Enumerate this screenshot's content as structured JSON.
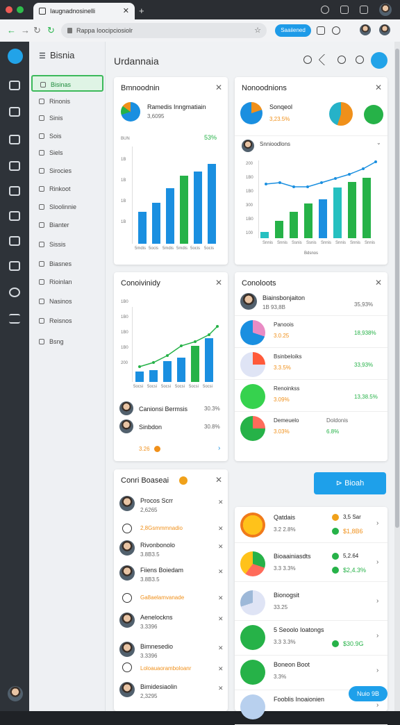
{
  "browser": {
    "tab_title": "Iaugnadnosinelli",
    "url": "Rappa Ioocipciosiolr",
    "pill_label": "Saaiiened"
  },
  "sidebar": {
    "title": "Bisnia",
    "items": [
      {
        "label": "Bisinas"
      },
      {
        "label": "Rinonis"
      },
      {
        "label": "Sinis"
      },
      {
        "label": "Sois"
      },
      {
        "label": "Siels"
      },
      {
        "label": "Sirocies"
      },
      {
        "label": "Rinkoot"
      },
      {
        "label": "Sloolinnie"
      },
      {
        "label": "Bianter"
      },
      {
        "label": "Sissis"
      },
      {
        "label": "Biasnes"
      },
      {
        "label": "Rioinlan"
      },
      {
        "label": "Nasinos"
      },
      {
        "label": "Reisnos"
      },
      {
        "label": "Bsng"
      }
    ]
  },
  "main": {
    "title": "Urdannaia"
  },
  "card1": {
    "title": "Bmnoodnin",
    "legend_name": "Ramedis Inngmatiain",
    "legend_sub": "3,6095",
    "top_value": "53%",
    "axis": [
      "BUN",
      "1B",
      "1B",
      "1B",
      "1B"
    ],
    "x_labels": [
      "5mdis",
      "5ocis",
      "5mdis",
      "5mdis",
      "5ocis",
      "5ocis"
    ]
  },
  "card2": {
    "title": "Nonoodnions",
    "name": "Sonqeol",
    "value": "3,23.5%",
    "person": "Snnioodlons",
    "axis": [
      "200",
      "1B0",
      "1B0",
      "300",
      "1B0",
      "100"
    ],
    "x_labels": [
      "Snnis",
      "Snnis",
      "Ssnis",
      "Ssnis",
      "Snnis",
      "Snnis",
      "Snnis",
      "Snnis"
    ],
    "x_title": "Bdsnos"
  },
  "card3": {
    "title": "Conoivinidy",
    "axis": [
      "1B0",
      "1B0",
      "1B0",
      "1B0",
      "200"
    ],
    "x_labels": [
      "5ocsi",
      "5ocsi",
      "5ocsi",
      "5ocsi",
      "5ocsi",
      "5ocsi"
    ],
    "people": [
      {
        "name": "Canionsi Bermsis",
        "value": "30.3%"
      },
      {
        "name": "Sinbdon",
        "value": "30.8%"
      }
    ],
    "foot": "3.26"
  },
  "card4": {
    "title": "Conoloots",
    "person_name": "Biainsbonjaiton",
    "person_sub": "1B 93,8B",
    "person_val": "35,93%",
    "rows": [
      {
        "name": "Panoois",
        "pct": "3.0.25",
        "val": "18,938%"
      },
      {
        "name": "Bsinbeloiks",
        "pct": "3.3.5%",
        "val": "33,93%"
      },
      {
        "name": "Renoinkss",
        "pct": "3.09%",
        "val": "13,38.5%"
      },
      {
        "name": "Demeuelo",
        "name2": "Doldonis",
        "pct": "3.03%",
        "pct2": "6.8%"
      }
    ]
  },
  "card5": {
    "title": "Conri Boaseai",
    "people": [
      {
        "name": "Procos Scrr",
        "sub": "2,6265"
      },
      {
        "name": "",
        "sub": "2,8Gsmmmnadio"
      },
      {
        "name": "Rivonbonolo",
        "sub": "3.8B3.5"
      },
      {
        "name": "Fiiens Boiedam",
        "sub": "3.8B3.5"
      },
      {
        "name": "",
        "sub": "Ga8aelamvanade"
      },
      {
        "name": "Aenelockns",
        "sub": "3.3396"
      },
      {
        "name": "Bimnesedio",
        "sub": "3.3396"
      },
      {
        "name": "",
        "sub": "Loloauaoramboloanr"
      },
      {
        "name": "Bimidesiaolin",
        "sub": "2,3295"
      }
    ]
  },
  "block_button": "Bioah",
  "card6": {
    "rows": [
      {
        "title": "Qatdais",
        "sub": "3.2 2.8%",
        "v1": "3,5 Sar",
        "v2": "$1,8B6"
      },
      {
        "title": "Bioaainiasdts",
        "sub": "3.3 3.3%",
        "v1": "5,2.64",
        "v2": "$2,4.3%"
      },
      {
        "title": "Bionogsit",
        "sub": "33.25",
        "v1": "",
        "v2": ""
      },
      {
        "title": "5 Seoolo Ioatongs",
        "sub": "3.3 3.3%",
        "v1": "",
        "v2": "$30.9G"
      },
      {
        "title": "Boneon Boot",
        "sub": "3.3%",
        "v1": "",
        "v2": ""
      },
      {
        "title": "Fooblis Inoaionien",
        "sub": "",
        "v1": "",
        "v2": ""
      }
    ],
    "chat_button": "Nuio 9B"
  }
}
